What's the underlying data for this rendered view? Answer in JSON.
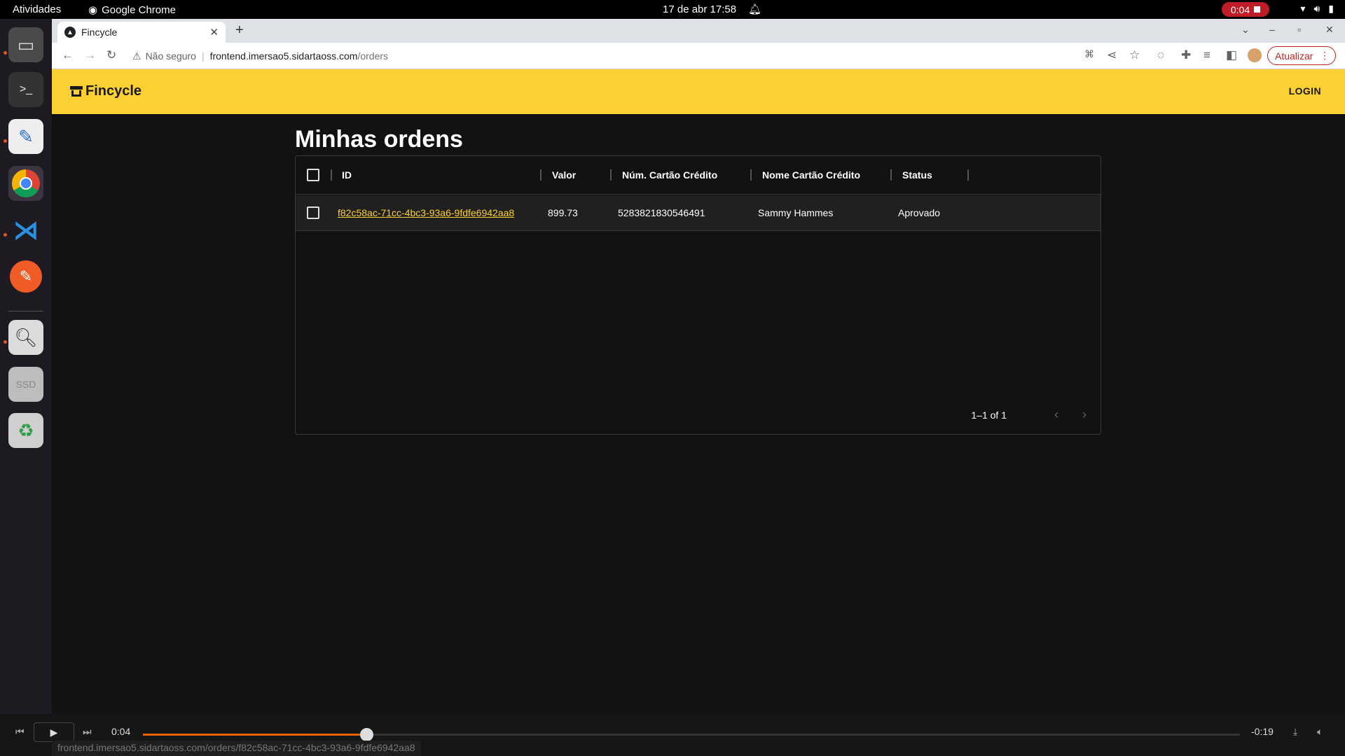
{
  "os": {
    "activities": "Atividades",
    "app_name": "Google Chrome",
    "clock": "17 de abr  17:58",
    "recording_time": "0:04"
  },
  "browser": {
    "tab_title": "Fincycle",
    "security_label": "Não seguro",
    "url_host": "frontend.imersao5.sidartaoss.com",
    "url_path": "/orders",
    "update_button": "Atualizar",
    "status_url": "frontend.imersao5.sidartaoss.com/orders/f82c58ac-71cc-4bc3-93a6-9fdfe6942aa8"
  },
  "app": {
    "brand": "Fincycle",
    "login": "LOGIN",
    "brand_color": "#fbd033"
  },
  "page": {
    "title": "Minhas ordens"
  },
  "table": {
    "columns": [
      "ID",
      "Valor",
      "Núm. Cartão Crédito",
      "Nome Cartão Crédito",
      "Status"
    ],
    "rows": [
      {
        "id": "f82c58ac-71cc-4bc3-93a6-9fdfe6942aa8",
        "valor": "899.73",
        "numero_cartao": "5283821830546491",
        "nome_cartao": "Sammy Hammes",
        "status": "Aprovado"
      }
    ],
    "pagination": "1–1 of 1"
  },
  "player": {
    "elapsed": "0:04",
    "remaining": "-0:19",
    "progress": 0.204
  }
}
